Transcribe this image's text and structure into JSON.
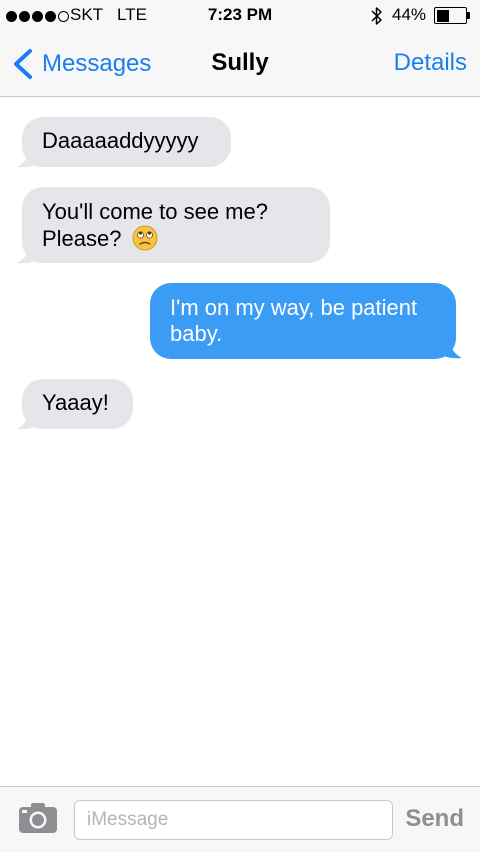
{
  "status_bar": {
    "signal_bars": 4,
    "signal_total": 5,
    "carrier": "SKT",
    "network": "LTE",
    "time": "7:23 PM",
    "bluetooth_icon": "bluetooth-icon",
    "battery_percent": "44%",
    "battery_level": 0.44
  },
  "nav": {
    "back_label": "Messages",
    "title": "Sully",
    "details_label": "Details"
  },
  "messages": [
    {
      "direction": "incoming",
      "text": "Daaaaaddyyyyy"
    },
    {
      "direction": "incoming",
      "text": "You'll come to see me?",
      "text2": "Please?",
      "emoji": "rolling-eyes-emoji"
    },
    {
      "direction": "outgoing",
      "text": "I'm on my way, be patient baby."
    },
    {
      "direction": "incoming",
      "text": "Yaaay!"
    }
  ],
  "input_bar": {
    "camera_icon": "camera-icon",
    "placeholder": "iMessage",
    "value": "",
    "send_label": "Send"
  },
  "colors": {
    "accent": "#1a7ef2",
    "incoming_bubble": "#e5e5ea",
    "outgoing_bubble": "#3a9cf5",
    "bar_background": "#f7f7f8",
    "send_disabled": "#8e8e93"
  }
}
